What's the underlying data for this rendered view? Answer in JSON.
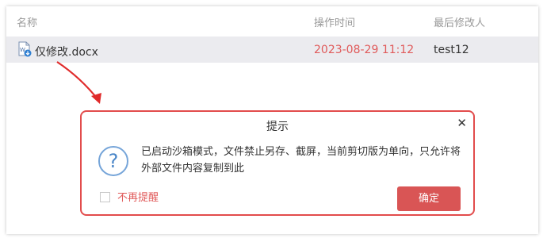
{
  "table": {
    "headers": {
      "name": "名称",
      "time": "操作时间",
      "modifier": "最后修改人"
    },
    "rows": [
      {
        "name": "仅修改.docx",
        "time": "2023-08-29 11:12",
        "modifier": "test12",
        "icon": "word-doc-icon"
      }
    ]
  },
  "dialog": {
    "title": "提示",
    "close": "✕",
    "icon": "question-icon",
    "icon_glyph": "?",
    "message": "已启动沙箱模式，文件禁止另存、截屏，当前剪切版为单向，只允许将外部文件内容复制到此",
    "checkbox_label": "不再提醒",
    "ok_label": "确定"
  },
  "colors": {
    "accent_red": "#e24c4c",
    "button_red": "#d95555",
    "icon_blue": "#4a86c8"
  }
}
